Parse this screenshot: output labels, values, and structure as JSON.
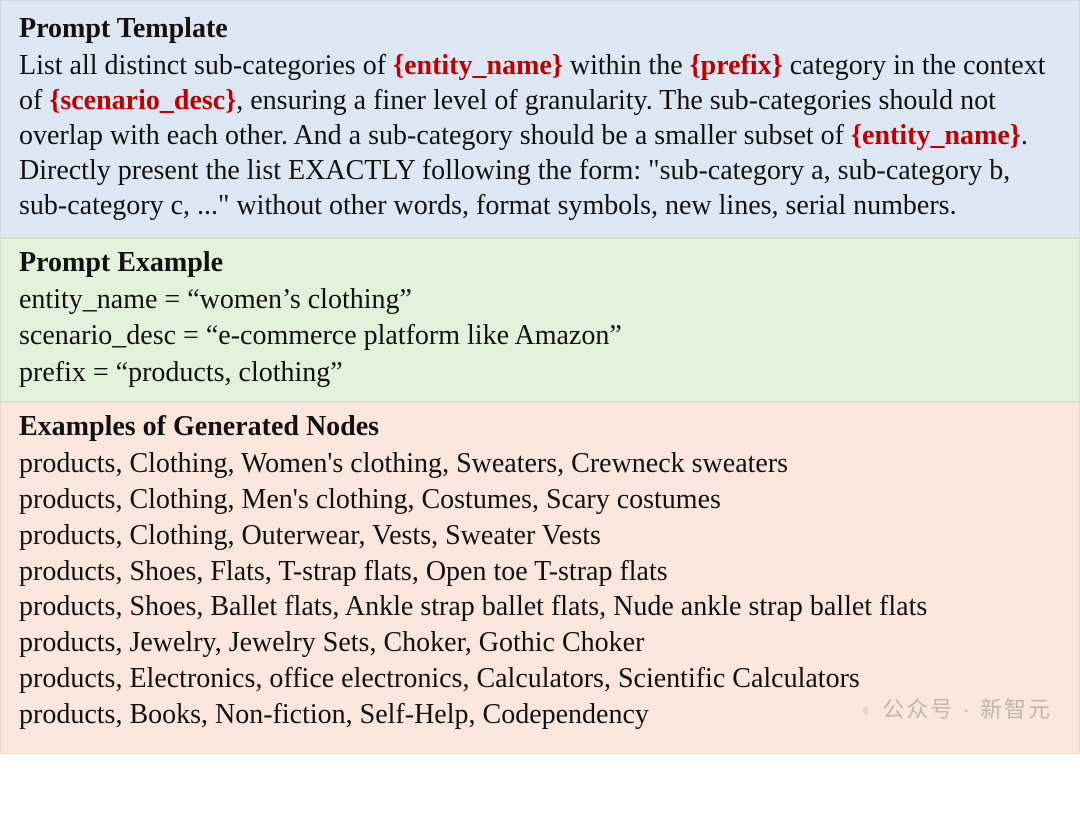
{
  "template": {
    "heading": "Prompt Template",
    "t1": "List all distinct sub-categories of ",
    "ph1": "{entity_name}",
    "t2": " within the ",
    "ph2": "{prefix}",
    "t3": " category in the context of ",
    "ph3": "{scenario_desc}",
    "t4": ", ensuring a finer level of granularity. The sub-categories should not overlap with each other. And a sub-category should be a smaller subset of ",
    "ph4": "{entity_name}",
    "t5": ". Directly present the list EXACTLY following the form: \"sub-category a, sub-category b, sub-category c, ...\" without other words, format symbols, new lines, serial numbers."
  },
  "example": {
    "heading": "Prompt Example",
    "vars": [
      {
        "name": "entity_name",
        "value": "“women’s clothing”"
      },
      {
        "name": "scenario_desc",
        "value": "“e-commerce platform like Amazon”"
      },
      {
        "name": "prefix",
        "value": "“products, clothing”"
      }
    ]
  },
  "nodes": {
    "heading": "Examples of Generated Nodes",
    "rows": [
      [
        "products",
        "Clothing",
        "Women's clothing",
        "Sweaters",
        "Crewneck sweaters"
      ],
      [
        "products",
        "Clothing",
        "Men's clothing",
        "Costumes",
        "Scary costumes"
      ],
      [
        "products",
        "Clothing",
        "Outerwear",
        "Vests",
        "Sweater Vests"
      ],
      [
        "products",
        "Shoes",
        "Flats",
        "T-strap flats",
        "Open toe T-strap flats"
      ],
      [
        "products",
        "Shoes",
        "Ballet flats",
        "Ankle strap ballet flats",
        "Nude ankle strap ballet flats"
      ],
      [
        "products",
        "Jewelry",
        "Jewelry Sets",
        "Choker",
        "Gothic Choker"
      ],
      [
        "products",
        "Electronics",
        "office electronics",
        "Calculators",
        "Scientific Calculators"
      ],
      [
        "products",
        "Books",
        "Non-fiction",
        "Self-Help",
        "Codependency"
      ]
    ]
  },
  "watermark": {
    "label": "公众号",
    "source": "新智元"
  }
}
